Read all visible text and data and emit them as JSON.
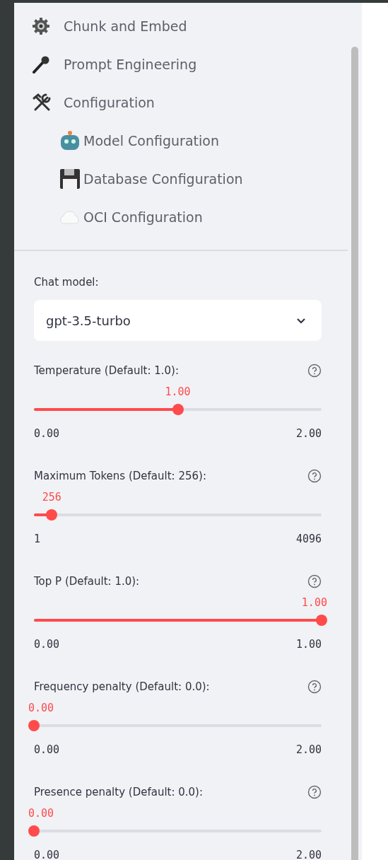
{
  "sidebar": {
    "nav": [
      {
        "label": "Chunk and Embed"
      },
      {
        "label": "Prompt Engineering"
      },
      {
        "label": "Configuration",
        "children": [
          {
            "label": "Model Configuration"
          },
          {
            "label": "Database Configuration"
          },
          {
            "label": "OCI Configuration"
          }
        ]
      }
    ],
    "chat_model": {
      "label": "Chat model:",
      "value": "gpt-3.5-turbo"
    },
    "sliders": [
      {
        "label": "Temperature (Default: 1.0):",
        "value": "1.00",
        "min": "0.00",
        "max": "2.00",
        "level": 0.5
      },
      {
        "label": "Maximum Tokens (Default: 256):",
        "value": "256",
        "min": "1",
        "max": "4096",
        "level": 0.062
      },
      {
        "label": "Top P (Default: 1.0):",
        "value": "1.00",
        "min": "0.00",
        "max": "1.00",
        "level": 1
      },
      {
        "label": "Frequency penalty (Default: 0.0):",
        "value": "0.00",
        "min": "0.00",
        "max": "2.00",
        "level": 0
      },
      {
        "label": "Presence penalty (Default: 0.0):",
        "value": "0.00",
        "min": "0.00",
        "max": "2.00",
        "level": 0
      }
    ]
  }
}
